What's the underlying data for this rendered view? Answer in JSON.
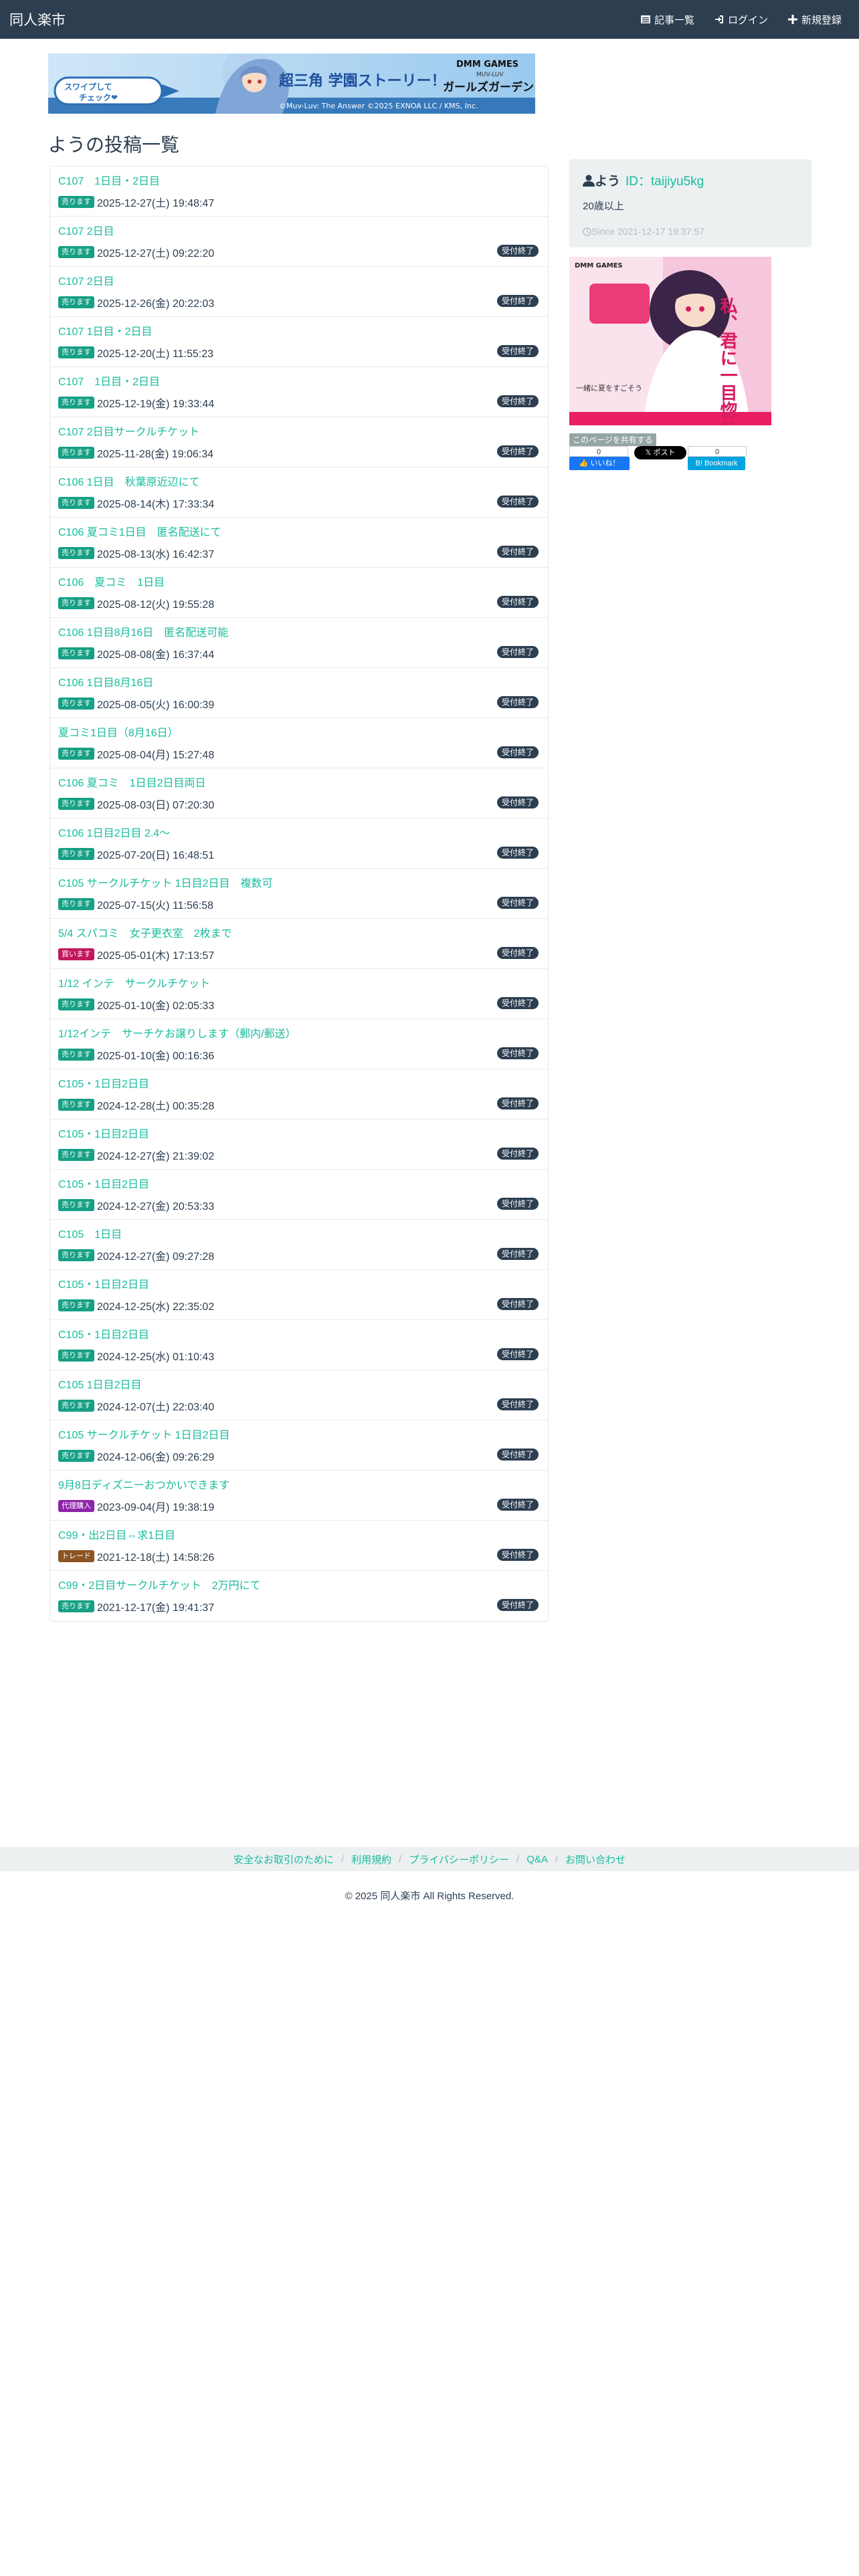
{
  "header": {
    "brand": "同人楽市",
    "links": [
      {
        "label": "記事一覧",
        "icon": "list-icon"
      },
      {
        "label": "ログイン",
        "icon": "login-icon"
      },
      {
        "label": "新規登録",
        "icon": "plus-icon"
      }
    ]
  },
  "banner": {
    "line1": "DMM GAMES",
    "line2": "MUV-LUV",
    "logo": "ガールズガーデン",
    "catch": "超三角 学園ストーリー！",
    "swipe": "スワイプして",
    "check": "チェック❤",
    "copyright": "©Muv-Luv: The Answer ©2025 EXNOA LLC / KMS, Inc."
  },
  "page_title": "ようの投稿一覧",
  "posts": [
    {
      "title": "C107　1日目・2日目",
      "type": "売ります",
      "date": "2025-12-27(土) 19:48:47",
      "status": ""
    },
    {
      "title": "C107 2日目",
      "type": "売ります",
      "date": "2025-12-27(土) 09:22:20",
      "status": "受付終了"
    },
    {
      "title": "C107 2日目",
      "type": "売ります",
      "date": "2025-12-26(金) 20:22:03",
      "status": "受付終了"
    },
    {
      "title": "C107 1日目・2日目",
      "type": "売ります",
      "date": "2025-12-20(土) 11:55:23",
      "status": "受付終了"
    },
    {
      "title": "C107　1日目・2日目",
      "type": "売ります",
      "date": "2025-12-19(金) 19:33:44",
      "status": "受付終了"
    },
    {
      "title": "C107 2日目サークルチケット",
      "type": "売ります",
      "date": "2025-11-28(金) 19:06:34",
      "status": "受付終了"
    },
    {
      "title": "C106 1日目　秋葉原近辺にて",
      "type": "売ります",
      "date": "2025-08-14(木) 17:33:34",
      "status": "受付終了"
    },
    {
      "title": "C106 夏コミ1日目　匿名配送にて",
      "type": "売ります",
      "date": "2025-08-13(水) 16:42:37",
      "status": "受付終了"
    },
    {
      "title": "C106　夏コミ　1日目",
      "type": "売ります",
      "date": "2025-08-12(火) 19:55:28",
      "status": "受付終了"
    },
    {
      "title": "C106 1日目8月16日　匿名配送可能",
      "type": "売ります",
      "date": "2025-08-08(金) 16:37:44",
      "status": "受付終了"
    },
    {
      "title": "C106 1日目8月16日",
      "type": "売ります",
      "date": "2025-08-05(火) 16:00:39",
      "status": "受付終了"
    },
    {
      "title": "夏コミ1日目（8月16日）",
      "type": "売ります",
      "date": "2025-08-04(月) 15:27:48",
      "status": "受付終了"
    },
    {
      "title": "C106 夏コミ　1日目2日目両日",
      "type": "売ります",
      "date": "2025-08-03(日) 07:20:30",
      "status": "受付終了"
    },
    {
      "title": "C106 1日目2日目 2.4〜",
      "type": "売ります",
      "date": "2025-07-20(日) 16:48:51",
      "status": "受付終了"
    },
    {
      "title": "C105 サークルチケット 1日目2日目　複数可",
      "type": "売ります",
      "date": "2025-07-15(火) 11:56:58",
      "status": "受付終了"
    },
    {
      "title": "5/4 スパコミ　女子更衣室　2枚まで",
      "type": "買います",
      "date": "2025-05-01(木) 17:13:57",
      "status": "受付終了"
    },
    {
      "title": "1/12 インテ　サークルチケット",
      "type": "売ります",
      "date": "2025-01-10(金) 02:05:33",
      "status": "受付終了"
    },
    {
      "title": "1/12インテ　サーチケお譲りします（郵内/郵送）",
      "type": "売ります",
      "date": "2025-01-10(金) 00:16:36",
      "status": "受付終了"
    },
    {
      "title": "C105・1日目2日目",
      "type": "売ります",
      "date": "2024-12-28(土) 00:35:28",
      "status": "受付終了"
    },
    {
      "title": "C105・1日目2日目",
      "type": "売ります",
      "date": "2024-12-27(金) 21:39:02",
      "status": "受付終了"
    },
    {
      "title": "C105・1日目2日目",
      "type": "売ります",
      "date": "2024-12-27(金) 20:53:33",
      "status": "受付終了"
    },
    {
      "title": "C105　1日目",
      "type": "売ります",
      "date": "2024-12-27(金) 09:27:28",
      "status": "受付終了"
    },
    {
      "title": "C105・1日目2日目",
      "type": "売ります",
      "date": "2024-12-25(水) 22:35:02",
      "status": "受付終了"
    },
    {
      "title": "C105・1日目2日目",
      "type": "売ります",
      "date": "2024-12-25(水) 01:10:43",
      "status": "受付終了"
    },
    {
      "title": "C105 1日目2日目",
      "type": "売ります",
      "date": "2024-12-07(土) 22:03:40",
      "status": "受付終了"
    },
    {
      "title": "C105 サークルチケット 1日目2日目",
      "type": "売ります",
      "date": "2024-12-06(金) 09:26:29",
      "status": "受付終了"
    },
    {
      "title": "9月8日ディズニーおつかいできます",
      "type": "代理購入",
      "date": "2023-09-04(月) 19:38:19",
      "status": "受付終了"
    },
    {
      "title": "C99・出2日目⇔求1日目",
      "type": "トレード",
      "date": "2021-12-18(土) 14:58:26",
      "status": "受付終了"
    },
    {
      "title": "C99・2日目サークルチケット　2万円にて",
      "type": "売ります",
      "date": "2021-12-17(金) 19:41:37",
      "status": "受付終了"
    }
  ],
  "badge_colors": {
    "売ります": "#16a085",
    "買います": "#c2185b",
    "代理購入": "#8e24aa",
    "トレード": "#8d5524"
  },
  "profile": {
    "name": "よう",
    "id_label": "ID：taijiyu5kg",
    "age": "20歳以上",
    "since": "Since 2021-12-17 19:37:57"
  },
  "side_ad": {
    "top": "DMM GAMES",
    "title": "私、君に一目惚れかしら",
    "sub": "一緒に夏をすごそう"
  },
  "share": {
    "label": "このページを共有する",
    "fb_count": "0",
    "fb_label": "いいね！",
    "x_label": "ポスト",
    "hatena_count": "0",
    "hatena_label": "Bookmark"
  },
  "footer": {
    "links": [
      "安全なお取引のために",
      "利用規約",
      "プライバシーポリシー",
      "Q&A",
      "お問い合わせ"
    ],
    "copyright": "© 2025 同人楽市 All Rights Reserved."
  }
}
